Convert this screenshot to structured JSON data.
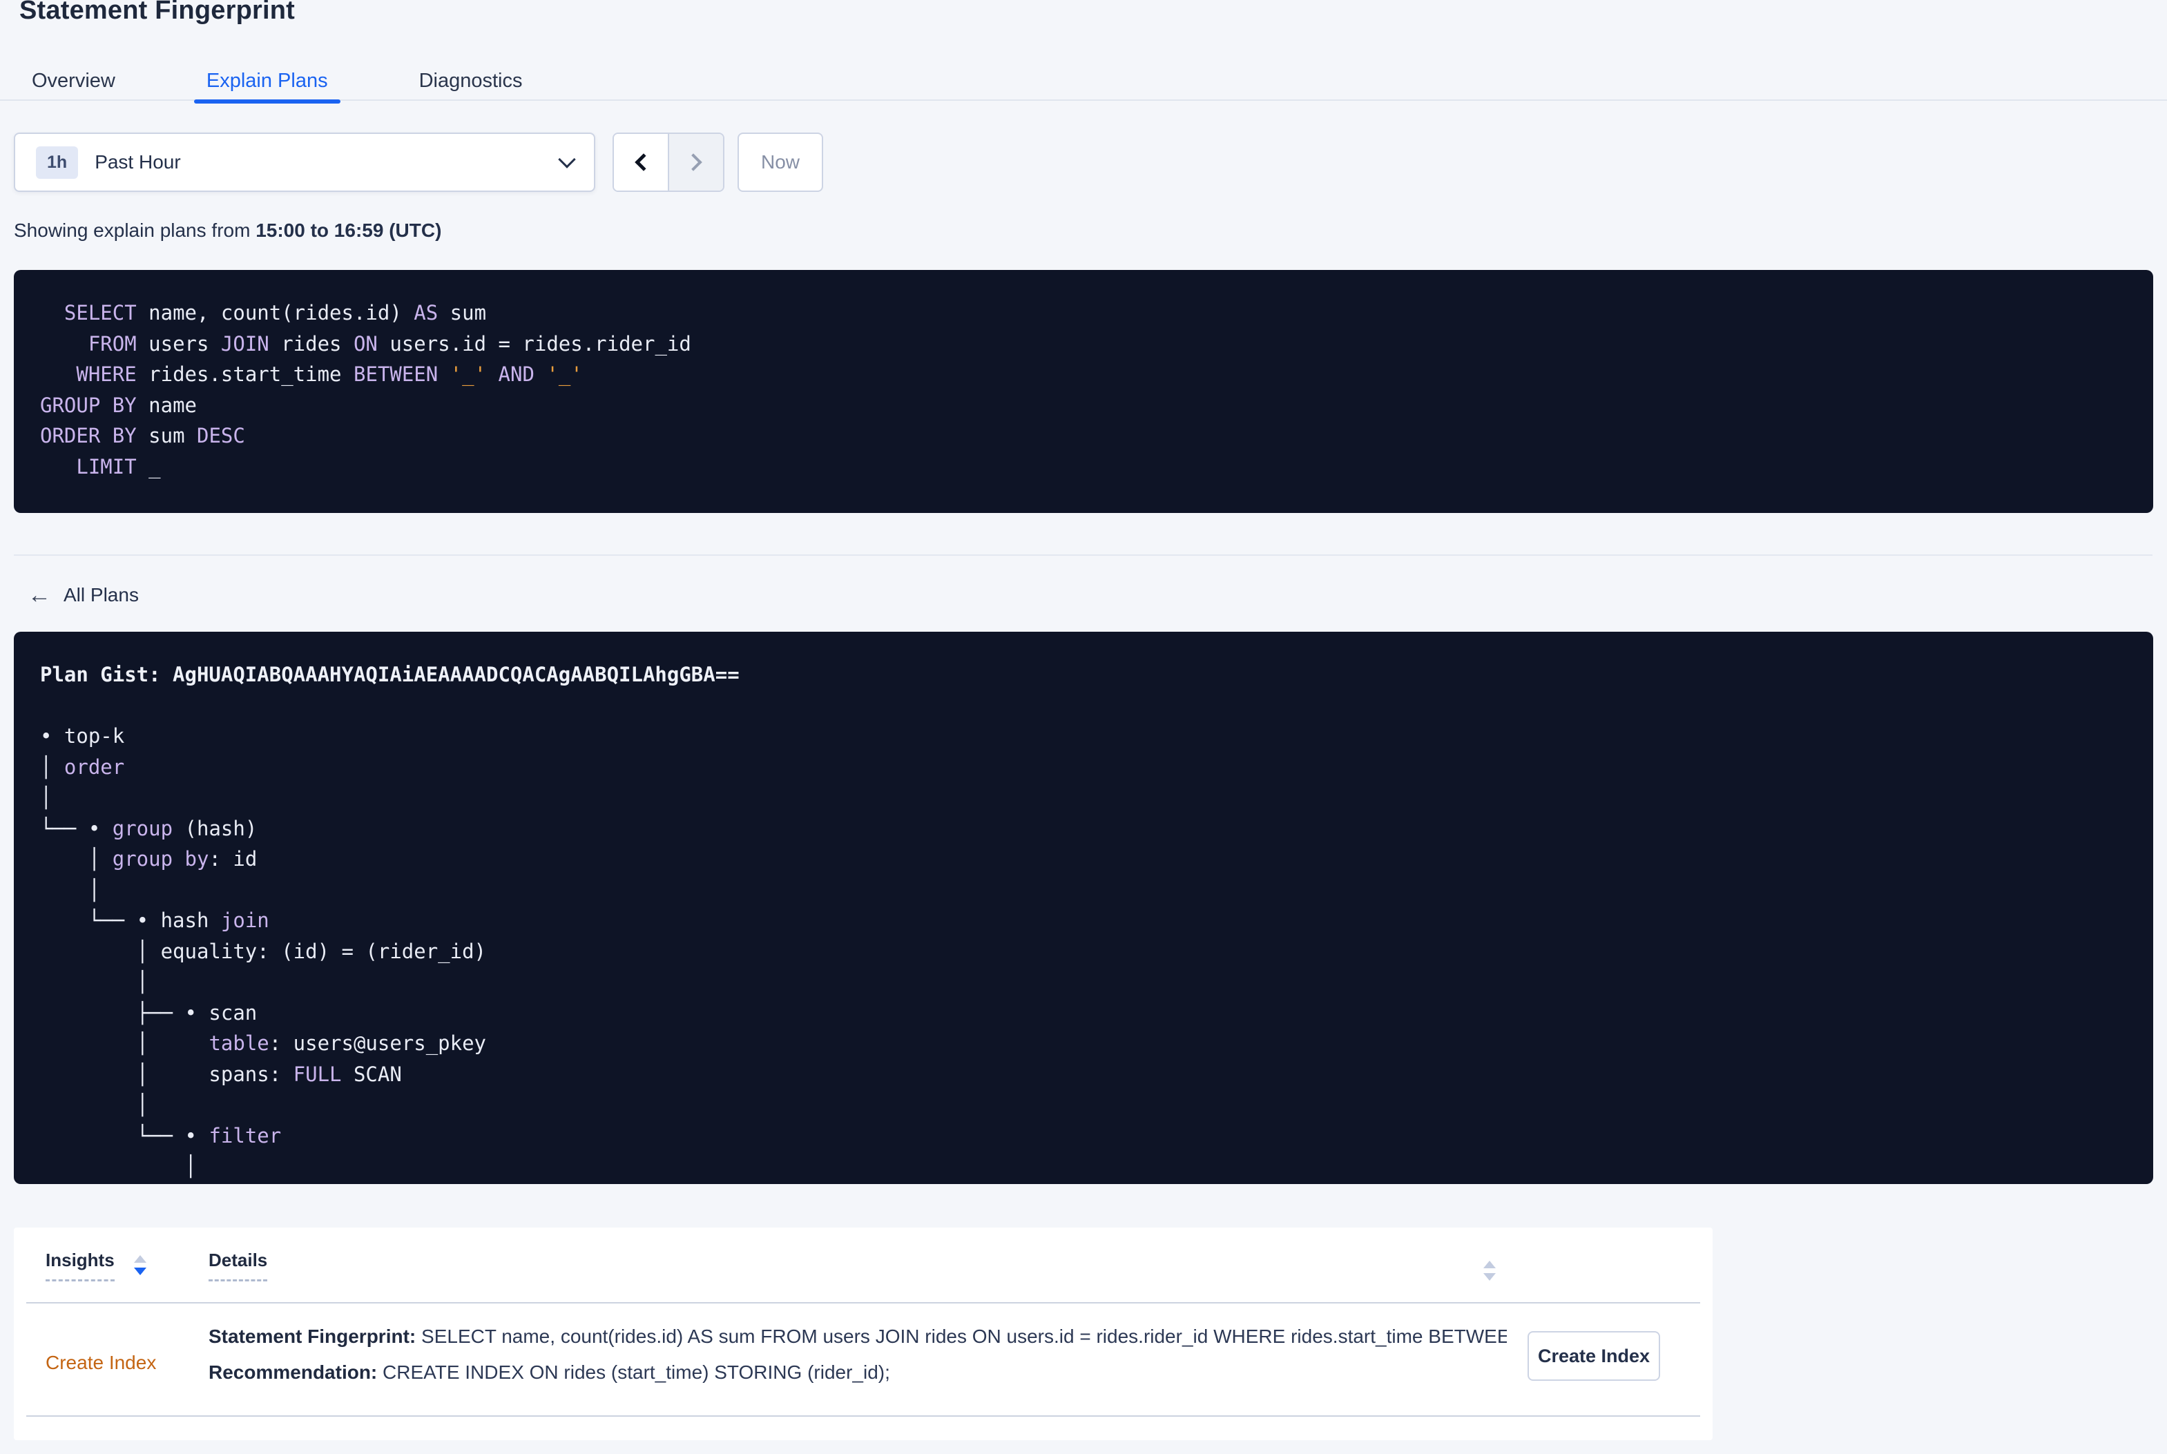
{
  "page_title": "Statement Fingerprint",
  "tabs": [
    {
      "label": "Overview"
    },
    {
      "label": "Explain Plans"
    },
    {
      "label": "Diagnostics"
    }
  ],
  "time_controls": {
    "interval_badge": "1h",
    "selected_range": "Past Hour",
    "now_label": "Now"
  },
  "showing_text": {
    "prefix": "Showing explain plans from",
    "range": "15:00 to 16:59 (UTC)"
  },
  "icons": {
    "back_arrow": "←"
  },
  "sql": {
    "lines": [
      [
        [
          "t",
          "  "
        ],
        [
          "k",
          "SELECT"
        ],
        [
          "t",
          " name, count(rides.id) "
        ],
        [
          "k",
          "AS"
        ],
        [
          "t",
          " sum"
        ]
      ],
      [
        [
          "t",
          "    "
        ],
        [
          "k",
          "FROM"
        ],
        [
          "t",
          " users "
        ],
        [
          "k",
          "JOIN"
        ],
        [
          "t",
          " rides "
        ],
        [
          "k",
          "ON"
        ],
        [
          "t",
          " users.id = rides.rider_id"
        ]
      ],
      [
        [
          "t",
          "   "
        ],
        [
          "k",
          "WHERE"
        ],
        [
          "t",
          " rides.start_time "
        ],
        [
          "k",
          "BETWEEN"
        ],
        [
          "t",
          " "
        ],
        [
          "s",
          "'_'"
        ],
        [
          "t",
          " "
        ],
        [
          "k",
          "AND"
        ],
        [
          "t",
          " "
        ],
        [
          "s",
          "'_'"
        ]
      ],
      [
        [
          "k",
          "GROUP BY"
        ],
        [
          "t",
          " name"
        ]
      ],
      [
        [
          "k",
          "ORDER BY"
        ],
        [
          "t",
          " sum "
        ],
        [
          "k",
          "DESC"
        ]
      ],
      [
        [
          "t",
          "   "
        ],
        [
          "k",
          "LIMIT"
        ],
        [
          "t",
          " _"
        ]
      ]
    ]
  },
  "back_link": {
    "label": "All Plans"
  },
  "plan": {
    "gist": "AgHUAQIABQAAAHYAQIAiAEAAAADCQACAgAABQILAhgGBA==",
    "lines": [
      [
        [
          "b",
          "Plan Gist: AgHUAQIABQAAAHYAQIAiAEAAAADCQACAgAABQILAhgGBA=="
        ]
      ],
      [],
      [
        [
          "t",
          "• top-k"
        ]
      ],
      [
        [
          "t",
          "│ "
        ],
        [
          "k",
          "order"
        ]
      ],
      [
        [
          "t",
          "│"
        ]
      ],
      [
        [
          "t",
          "└── • "
        ],
        [
          "k",
          "group"
        ],
        [
          "t",
          " (hash)"
        ]
      ],
      [
        [
          "t",
          "    │ "
        ],
        [
          "k",
          "group by"
        ],
        [
          "t",
          ": id"
        ]
      ],
      [
        [
          "t",
          "    │"
        ]
      ],
      [
        [
          "t",
          "    └── • hash "
        ],
        [
          "k",
          "join"
        ]
      ],
      [
        [
          "t",
          "        │ equality: (id) = (rider_id)"
        ]
      ],
      [
        [
          "t",
          "        │"
        ]
      ],
      [
        [
          "t",
          "        ├── • scan"
        ]
      ],
      [
        [
          "t",
          "        │     "
        ],
        [
          "k",
          "table"
        ],
        [
          "t",
          ": users@users_pkey"
        ]
      ],
      [
        [
          "t",
          "        │     spans: "
        ],
        [
          "k",
          "FULL"
        ],
        [
          "t",
          " SCAN"
        ]
      ],
      [
        [
          "t",
          "        │"
        ]
      ],
      [
        [
          "t",
          "        └── • "
        ],
        [
          "k",
          "filter"
        ]
      ],
      [
        [
          "t",
          "            │"
        ]
      ]
    ]
  },
  "insights_table": {
    "columns": [
      {
        "label": "Insights",
        "sort": "desc"
      },
      {
        "label": "Details",
        "sort": "none"
      }
    ],
    "row": {
      "insight_link": "Create Index",
      "fingerprint_label": "Statement Fingerprint:",
      "fingerprint_text": "SELECT name, count(rides.id) AS sum FROM users JOIN rides ON users.id = rides.rider_id WHERE rides.start_time BETWEEN '_…",
      "recommendation_label": "Recommendation:",
      "recommendation_text": "CREATE INDEX ON rides (start_time) STORING (rider_id);",
      "action_button": "Create Index"
    }
  },
  "colors": {
    "accent_blue": "#1a63f1",
    "code_keyword": "#c9b4ec",
    "code_literal": "#e89d3d",
    "insight_orange": "#c46513",
    "card_dark": "#0e1426"
  }
}
